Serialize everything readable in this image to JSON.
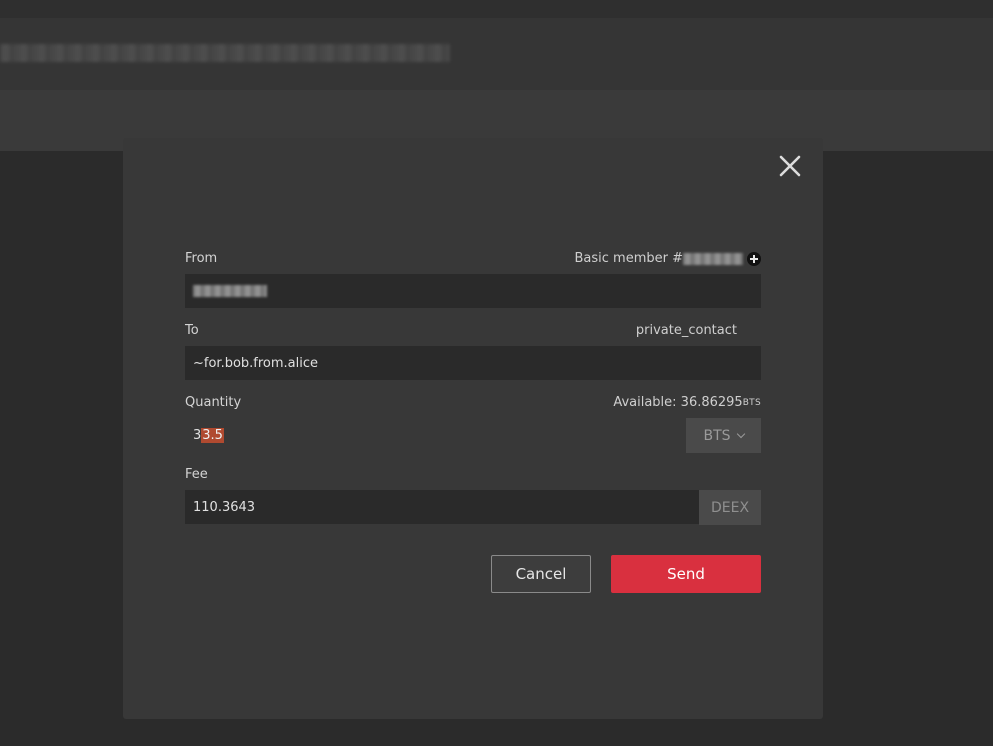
{
  "background": {
    "header_text_blurred": "redacted header text"
  },
  "modal": {
    "close_icon": "close-icon",
    "from": {
      "label": "From",
      "membership": "Basic member #",
      "account_value_redacted": "redacted account",
      "add_icon": "plus-circle-icon"
    },
    "to": {
      "label": "To",
      "contact_type": "private_contact",
      "value": "~for.bob.from.alice"
    },
    "quantity": {
      "label": "Quantity",
      "available_prefix": "Available: ",
      "available_amount": "36.86295",
      "available_unit": "BTS",
      "value_plain": "3",
      "value_selected": "3.5",
      "asset": "BTS"
    },
    "fee": {
      "label": "Fee",
      "value": "110.3643",
      "asset": "DEEX"
    },
    "buttons": {
      "cancel": "Cancel",
      "send": "Send"
    }
  },
  "colors": {
    "send_button": "#d9303f",
    "selection_highlight": "#b04a30",
    "modal_bg": "#383838",
    "page_bg": "#2b2b2b"
  }
}
